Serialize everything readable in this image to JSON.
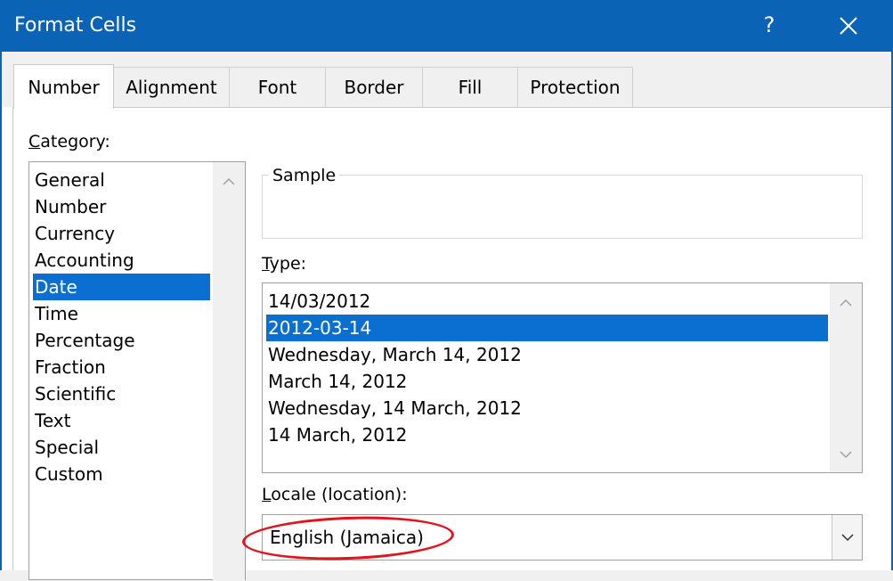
{
  "dialog": {
    "title": "Format Cells",
    "help_label": "?"
  },
  "tabs": [
    {
      "label": "Number",
      "active": true
    },
    {
      "label": "Alignment"
    },
    {
      "label": "Font"
    },
    {
      "label": "Border"
    },
    {
      "label": "Fill"
    },
    {
      "label": "Protection"
    }
  ],
  "category": {
    "label_underlined": "C",
    "label_rest": "ategory:",
    "items": [
      "General",
      "Number",
      "Currency",
      "Accounting",
      "Date",
      "Time",
      "Percentage",
      "Fraction",
      "Scientific",
      "Text",
      "Special",
      "Custom"
    ],
    "selected": "Date"
  },
  "sample": {
    "label": "Sample",
    "value": ""
  },
  "type": {
    "label_underlined": "T",
    "label_rest": "ype:",
    "items": [
      "14/03/2012",
      "2012-03-14",
      "Wednesday, March 14, 2012",
      "March 14, 2012",
      "Wednesday, 14 March, 2012",
      "14 March, 2012"
    ],
    "selected": "2012-03-14"
  },
  "locale": {
    "label_underlined": "L",
    "label_rest": "ocale (location):",
    "value": "English (Jamaica)"
  },
  "icons": {
    "close": "close-icon",
    "scroll_up": "chevron-up-icon",
    "scroll_down": "chevron-down-icon",
    "dropdown": "chevron-down-icon"
  },
  "colors": {
    "titlebar": "#0a63b5",
    "selection": "#0a6fd0",
    "highlight_ellipse": "#e0141c"
  }
}
